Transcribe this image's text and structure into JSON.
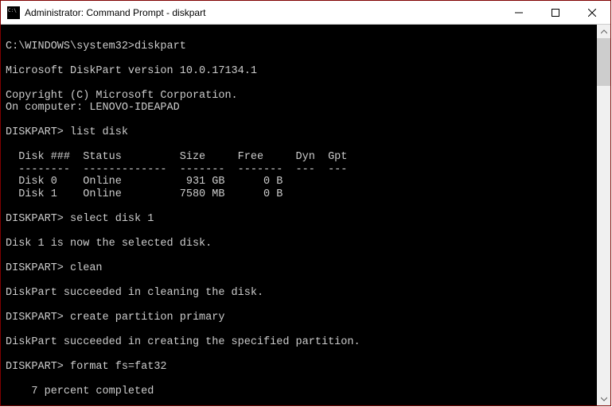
{
  "window": {
    "title": "Administrator: Command Prompt - diskpart"
  },
  "terminal": {
    "lines": [
      "",
      "C:\\WINDOWS\\system32>diskpart",
      "",
      "Microsoft DiskPart version 10.0.17134.1",
      "",
      "Copyright (C) Microsoft Corporation.",
      "On computer: LENOVO-IDEAPAD",
      "",
      "DISKPART> list disk",
      "",
      "  Disk ###  Status         Size     Free     Dyn  Gpt",
      "  --------  -------------  -------  -------  ---  ---",
      "  Disk 0    Online          931 GB      0 B",
      "  Disk 1    Online         7580 MB      0 B",
      "",
      "DISKPART> select disk 1",
      "",
      "Disk 1 is now the selected disk.",
      "",
      "DISKPART> clean",
      "",
      "DiskPart succeeded in cleaning the disk.",
      "",
      "DISKPART> create partition primary",
      "",
      "DiskPart succeeded in creating the specified partition.",
      "",
      "DISKPART> format fs=fat32",
      "",
      "    7 percent completed"
    ]
  }
}
